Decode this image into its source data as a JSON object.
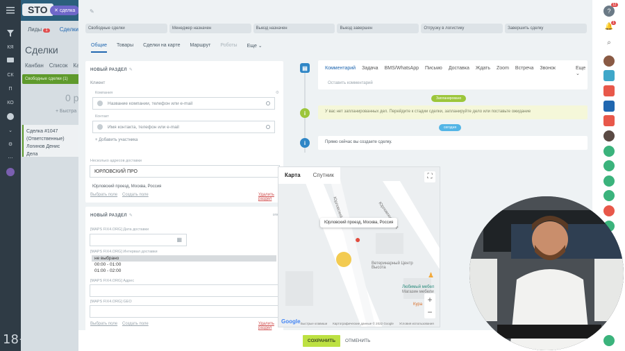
{
  "left_rail": {
    "items": [
      "КЯ",
      "СК",
      "П",
      "КО"
    ],
    "age_rating": "18+"
  },
  "background": {
    "logo": "STO",
    "deal_chip": "сделка",
    "tabs": [
      "Лиды",
      "Сделки"
    ],
    "lead_badge": "1",
    "title": "Сделки",
    "views": [
      "Канбан",
      "Список",
      "Кал"
    ],
    "stage_green": "Свободные сделки (1)",
    "zero": "0 р",
    "quick": "+ Быстра",
    "card": {
      "title": "Сделка #1047",
      "sub": "(Ответственные)",
      "user": "Логинов Денис",
      "deals": "Дела"
    }
  },
  "stages": [
    "Свободные сделки",
    "Менеджер назначен",
    "Выезд назначен",
    "Выезд завершен",
    "Отгрузку в логистику",
    "Завершить сделку"
  ],
  "tabs": {
    "items": [
      "Общие",
      "Товары",
      "Сделки на карте",
      "Маршрут",
      "Роботы",
      "Еще ⌄"
    ],
    "active": "Общие"
  },
  "section1": {
    "title": "НОВЫЙ РАЗДЕЛ",
    "client_label": "Клиент",
    "company_label": "Компания",
    "company_placeholder": "Название компании, телефон или e-mail",
    "contact_label": "Контакт",
    "contact_placeholder": "Имя контакта, телефон или e-mail",
    "add_participant": "+ Добавить участника",
    "delivery_label": "Несколько адресов доставки",
    "delivery_value": "ЮРЛОВСКИЙ ПРО",
    "delivery_full": "Юрловский проезд, Москва, Россия",
    "choose_field": "Выбрать поле",
    "create_field": "Создать поле",
    "delete_section": "Удалить раздел"
  },
  "section2": {
    "title": "НОВЫЙ РАЗДЕЛ",
    "cancel": "отм",
    "date_label": "[MAPS FIX4.ORG] Дата доставки",
    "interval_label": "[MAPS FIX4.ORG] Интервал доставки",
    "options": [
      "не выбрано",
      "00:00 - 01:00",
      "01:00 - 02:00"
    ],
    "address_label": "[MAPS FIX4.ORG] Адрес",
    "geo_label": "[MAPS FIX4.ORG] GEO",
    "choose_field": "Выбрать поле",
    "create_field": "Создать поле",
    "delete_section": "Удалить раздел"
  },
  "map": {
    "tabs": [
      "Карта",
      "Спутник"
    ],
    "active_tab": "Карта",
    "tooltip": "Юрловский проезд, Москва, Россия",
    "street1": "Юрловский пр-д",
    "street2": "Юрловский пр-д",
    "vet": "Ветеринарный Центр Высота",
    "furniture": "Любимый мебел",
    "furniture_sub": "Магазин мебели",
    "kura": "Кура",
    "google": "Google",
    "footer": [
      "Быстрые клавиши",
      "Картографические данные © 2022 Google",
      "Условия использования"
    ]
  },
  "activity": {
    "tabs": [
      "Комментарий",
      "Задача",
      "BMS/WhatsApp",
      "Письмо",
      "Доставка",
      "Ждать",
      "Zoom",
      "Встреча",
      "Звонок",
      "Еще ⌄"
    ],
    "active": "Комментарий",
    "placeholder": "Оставить комментарий",
    "planned_pill": "Запланировано",
    "planned_note": "У вас нет запланированных дел. Перейдите к стадии сделки, запланируйте дело или поставьте ожидание",
    "today_pill": "сегодня",
    "today_note": "Прямо сейчас вы создаете сделку."
  },
  "footer": {
    "save": "СОХРАНИТЬ",
    "cancel": "ОТМЕНИТЬ"
  },
  "right_rail": {
    "badge_help": "12",
    "badge_bell": "1"
  },
  "colors": {
    "accent": "#2067b0",
    "save": "#bde142",
    "green": "#9cc63b",
    "blue_pill": "#53b5e6"
  }
}
